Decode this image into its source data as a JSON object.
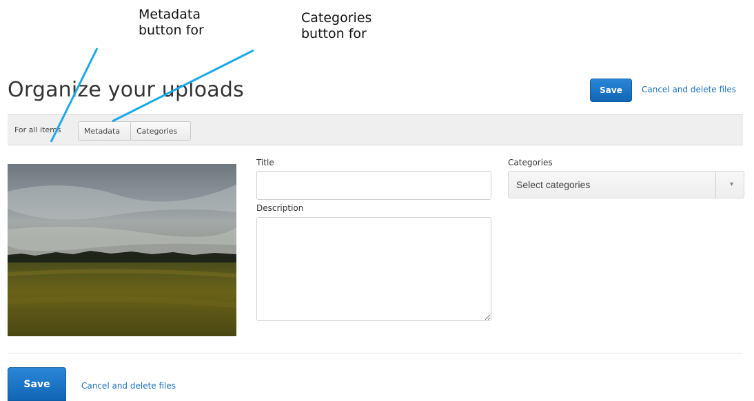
{
  "annotations": {
    "metadata_line1": "Metadata",
    "metadata_line2": "button for",
    "categories_line1": "Categories",
    "categories_line2": "button for",
    "line_color": "#19a9e8"
  },
  "page": {
    "title": "Organize your uploads"
  },
  "actions": {
    "save_label": "Save",
    "cancel_label": "Cancel and delete files"
  },
  "toolbar": {
    "for_all_label": "For all items",
    "metadata_button": "Metadata",
    "categories_button": "Categories"
  },
  "form": {
    "title_label": "Title",
    "title_value": "",
    "description_label": "Description",
    "description_value": "",
    "categories_label": "Categories",
    "categories_placeholder": "Select categories",
    "caret_icon": "chevron-down-icon"
  },
  "photo": {
    "subject": "landscape-thumbnail-icon"
  },
  "colors": {
    "accent": "#1a6fc0",
    "save_button": "#1a73c8"
  }
}
